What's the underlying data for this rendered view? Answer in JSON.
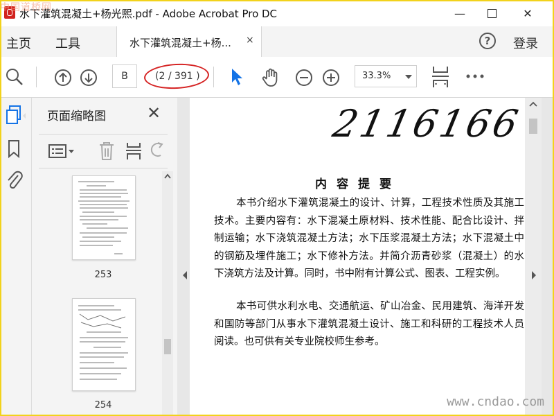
{
  "window": {
    "title": "水下灌筑混凝土+杨光熙.pdf - Adobe Acrobat Pro DC",
    "minimize_glyph": "—",
    "close_glyph": "✕"
  },
  "watermarks": {
    "top": "中国道桥网",
    "bottom": "www.cndao.com"
  },
  "tabbar": {
    "home": "主页",
    "tools": "工具",
    "doc_tab": "水下灌筑混凝土+杨...",
    "doc_tab_close": "×",
    "help": "?",
    "login": "登录"
  },
  "toolbar": {
    "page_input": "B",
    "page_count": "(2 / 391 )",
    "zoom": "33.3%",
    "icons": [
      "search-icon",
      "page-up-icon",
      "page-down-icon",
      "select-arrow-icon",
      "hand-icon",
      "zoom-out-icon",
      "zoom-in-icon",
      "fit-page-icon",
      "more-icon"
    ]
  },
  "thumbnails": {
    "title": "页面缩略图",
    "close": "✕",
    "pages": [
      {
        "label": "253"
      },
      {
        "label": "254"
      }
    ]
  },
  "document": {
    "handwriting": "2116166",
    "heading": "内容提要",
    "paragraph1": "本书介绍水下灌筑混凝土的设计、计算，工程技术性质及其施工技术。主要内容有：水下混凝土原材料、技术性能、配合比设计、拌制运输；水下浇筑混凝土方法；水下压浆混凝土方法；水下混凝土中的钢筋及埋件施工；水下修补方法。并简介沥青砂浆（混凝土）的水下浇筑方法及计算。同时，书中附有计算公式、图表、工程实例。",
    "paragraph2": "本书可供水利水电、交通航运、矿山冶金、民用建筑、海洋开发和国防等部门从事水下灌筑混凝土设计、施工和科研的工程技术人员阅读。也可供有关专业院校师生参考。"
  },
  "colors": {
    "accent_blue": "#1473e6",
    "annotation_red": "#d52222",
    "frame_yellow": "#f2d21b"
  }
}
